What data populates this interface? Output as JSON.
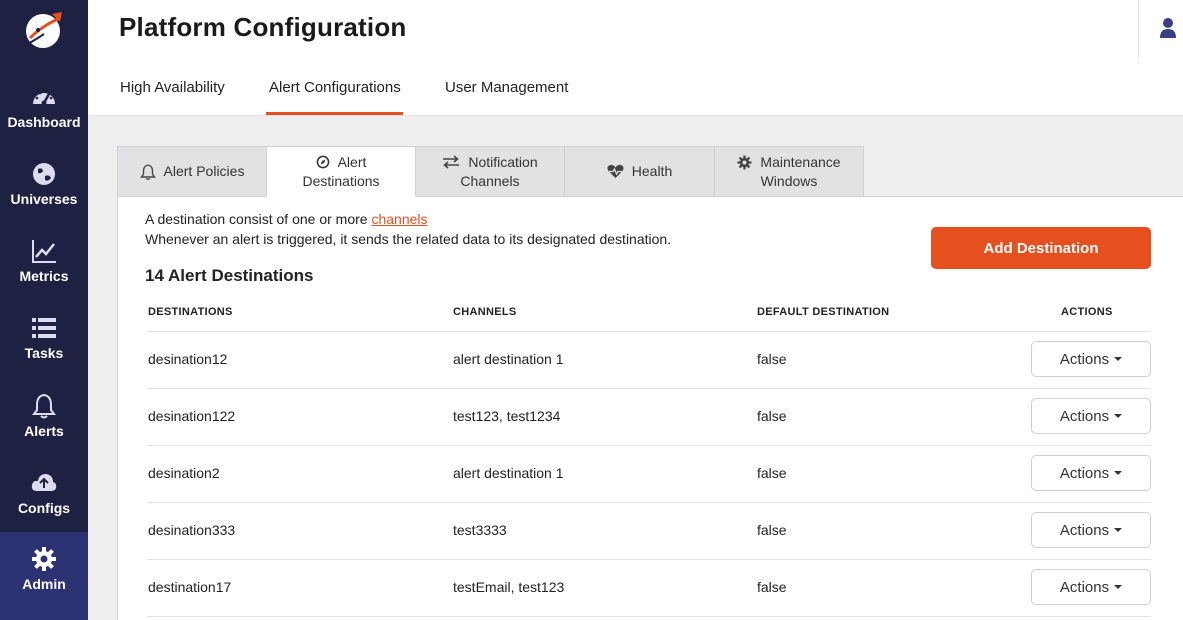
{
  "sidebar": {
    "items": [
      {
        "label": "Dashboard",
        "icon": "dashboard-gauge-icon"
      },
      {
        "label": "Universes",
        "icon": "globe-icon"
      },
      {
        "label": "Metrics",
        "icon": "line-chart-icon"
      },
      {
        "label": "Tasks",
        "icon": "list-icon"
      },
      {
        "label": "Alerts",
        "icon": "bell-icon"
      },
      {
        "label": "Configs",
        "icon": "cloud-upload-icon"
      },
      {
        "label": "Admin",
        "icon": "gear-icon",
        "active": true
      }
    ]
  },
  "header": {
    "title": "Platform Configuration",
    "tabs": [
      "High Availability",
      "Alert Configurations",
      "User Management"
    ],
    "active_tab": "Alert Configurations"
  },
  "subtabs": [
    {
      "line1": "Alert Policies",
      "line2": "",
      "icon": "bell-outline-icon"
    },
    {
      "line1": "Alert",
      "line2": "Destinations",
      "icon": "compass-icon",
      "active": true
    },
    {
      "line1": "Notification",
      "line2": "Channels",
      "icon": "exchange-arrows-icon"
    },
    {
      "line1": "Health",
      "line2": "",
      "icon": "heartbeat-icon"
    },
    {
      "line1": "Maintenance",
      "line2": "Windows",
      "icon": "cog-icon"
    }
  ],
  "panel": {
    "desc_prefix": "A destination consist of one or more ",
    "desc_link": "channels",
    "desc_line2": "Whenever an alert is triggered, it sends the related data to its designated destination.",
    "count_title": "14 Alert Destinations",
    "add_button": "Add Destination"
  },
  "table": {
    "headers": [
      "DESTINATIONS",
      "CHANNELS",
      "DEFAULT DESTINATION",
      "ACTIONS"
    ],
    "action_label": "Actions",
    "rows": [
      {
        "destination": "desination12",
        "channels": "alert destination 1",
        "default": "false"
      },
      {
        "destination": "desination122",
        "channels": "test123, test1234",
        "default": "false"
      },
      {
        "destination": "desination2",
        "channels": "alert destination 1",
        "default": "false"
      },
      {
        "destination": "desination333",
        "channels": "test3333",
        "default": "false"
      },
      {
        "destination": "destination17",
        "channels": "testEmail, test123",
        "default": "false"
      }
    ]
  },
  "colors": {
    "sidebar_bg": "#1f2143",
    "sidebar_active": "#2d3372",
    "accent": "#e5501e"
  }
}
